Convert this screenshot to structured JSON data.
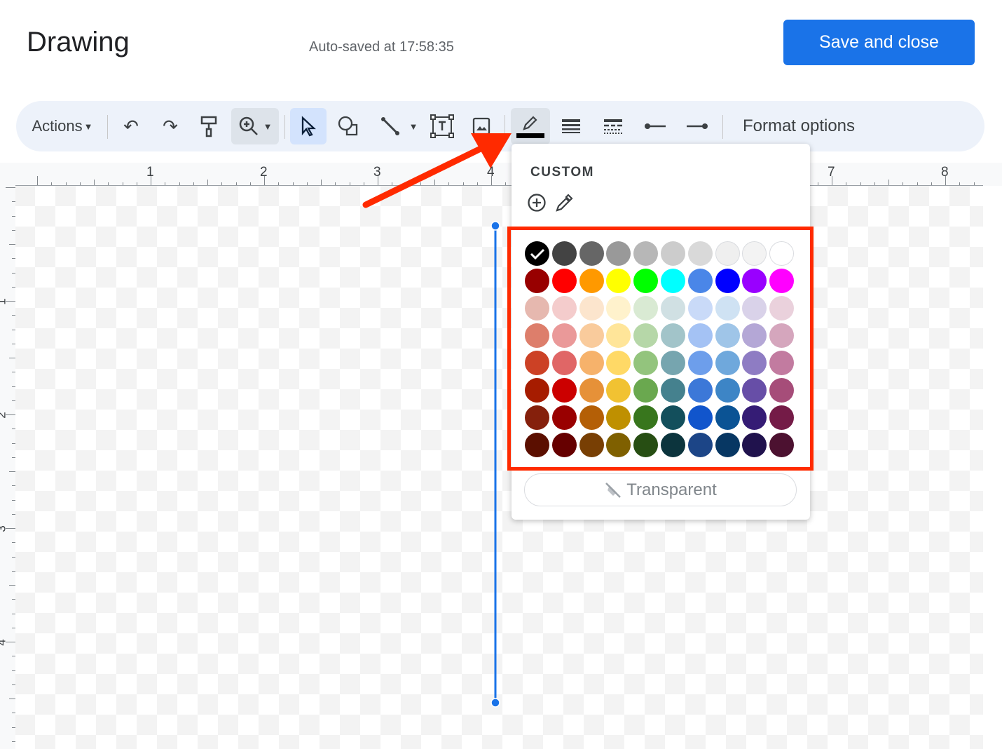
{
  "header": {
    "title": "Drawing",
    "autosave": "Auto-saved at 17:58:35",
    "save_label": "Save and close"
  },
  "toolbar": {
    "actions_label": "Actions",
    "format_options": "Format options",
    "icons": [
      "undo-icon",
      "redo-icon",
      "paint-format-icon",
      "zoom-icon",
      "select-icon",
      "shape-icon",
      "line-icon",
      "text-box-icon",
      "image-icon",
      "line-color-icon",
      "line-weight-icon",
      "line-dash-icon",
      "line-start-icon",
      "line-end-icon"
    ]
  },
  "ruler": {
    "top": [
      "1",
      "2",
      "3",
      "4",
      "7",
      "8"
    ],
    "left": [
      "1",
      "2",
      "3",
      "4"
    ]
  },
  "color_popup": {
    "custom_label": "CUSTOM",
    "transparent_label": "Transparent",
    "selected": "#000000",
    "accent": "#ff2a00",
    "rows": [
      [
        "#000000",
        "#434343",
        "#666666",
        "#999999",
        "#b7b7b7",
        "#cccccc",
        "#d9d9d9",
        "#efefef",
        "#f3f3f3",
        "#ffffff"
      ],
      [
        "#980000",
        "#ff0000",
        "#ff9900",
        "#ffff00",
        "#00ff00",
        "#00ffff",
        "#4a86e8",
        "#0000ff",
        "#9900ff",
        "#ff00ff"
      ],
      [
        "#e6b8af",
        "#f4cccc",
        "#fce5cd",
        "#fff2cc",
        "#d9ead3",
        "#d0e0e3",
        "#c9daf8",
        "#cfe2f3",
        "#d9d2e9",
        "#ead1dc"
      ],
      [
        "#dd7e6b",
        "#ea9999",
        "#f9cb9c",
        "#ffe599",
        "#b6d7a8",
        "#a2c4c9",
        "#a4c2f4",
        "#9fc5e8",
        "#b4a7d6",
        "#d5a6bd"
      ],
      [
        "#cc4125",
        "#e06666",
        "#f6b26b",
        "#ffd966",
        "#93c47d",
        "#76a5af",
        "#6d9eeb",
        "#6fa8dc",
        "#8e7cc3",
        "#c27ba0"
      ],
      [
        "#a61c00",
        "#cc0000",
        "#e69138",
        "#f1c232",
        "#6aa84f",
        "#45818e",
        "#3c78d8",
        "#3d85c6",
        "#674ea7",
        "#a64d79"
      ],
      [
        "#85200c",
        "#990000",
        "#b45f06",
        "#bf9000",
        "#38761d",
        "#134f5c",
        "#1155cc",
        "#0b5394",
        "#351c75",
        "#741b47"
      ],
      [
        "#5b0f00",
        "#660000",
        "#783f04",
        "#7f6000",
        "#274e13",
        "#0c343d",
        "#1c4587",
        "#073763",
        "#20124d",
        "#4c1130"
      ]
    ]
  }
}
